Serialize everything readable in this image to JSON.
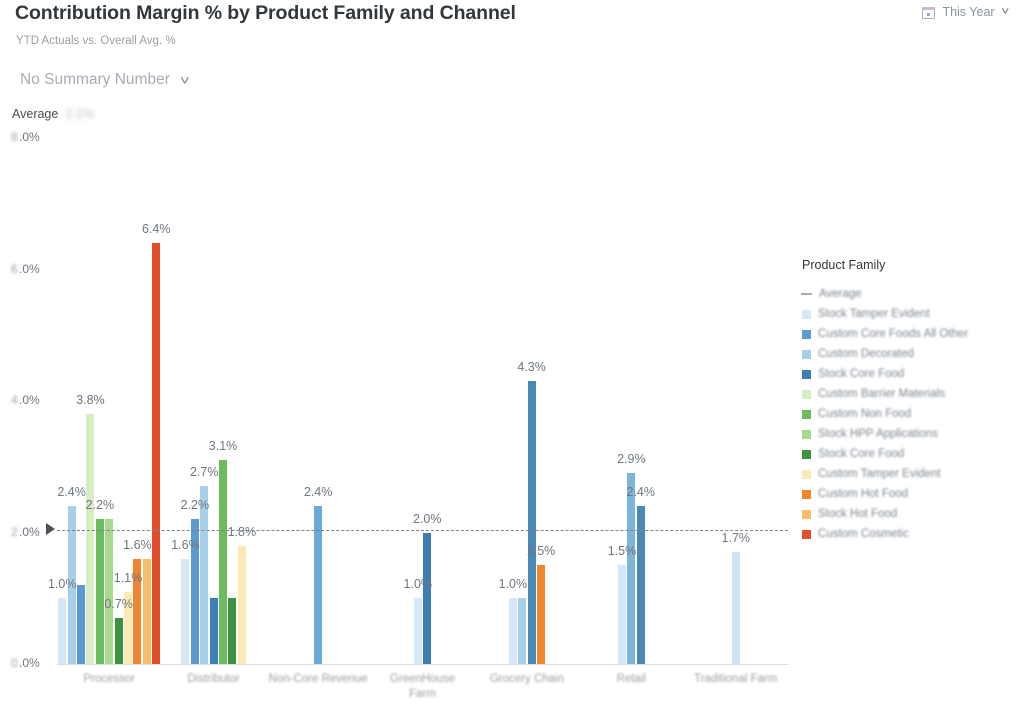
{
  "header": {
    "title": "Contribution Margin % by Product Family and Channel",
    "subtitle": "YTD Actuals vs. Overall Avg. %",
    "summary_select": "No Summary Number",
    "summary_chevron": "chevron-down-icon",
    "average_label": "Average",
    "average_value": "2.1%",
    "date_filter": "This Year",
    "calendar_icon": "calendar-icon",
    "date_chevron": "chevron-down-icon"
  },
  "legend": {
    "title": "Product Family",
    "items": [
      {
        "label": "Average",
        "color": "#b5a9a3",
        "type": "line"
      },
      {
        "label": "Stock Tamper Evident",
        "color": "#d6e7f7",
        "type": "swatch"
      },
      {
        "label": "Custom Core Foods All Other",
        "color": "#5b9bd1",
        "type": "swatch"
      },
      {
        "label": "Custom Decorated",
        "color": "#a8cfea",
        "type": "swatch"
      },
      {
        "label": "Stock Core Food",
        "color": "#3d7fb5",
        "type": "swatch"
      },
      {
        "label": "Custom Barrier Materials",
        "color": "#d8edc4",
        "type": "swatch"
      },
      {
        "label": "Custom Non Food",
        "color": "#6cbb5d",
        "type": "swatch"
      },
      {
        "label": "Stock HPP Applications",
        "color": "#a9d98e",
        "type": "swatch"
      },
      {
        "label": "Stock Core Food",
        "color": "#3f9142",
        "type": "swatch"
      },
      {
        "label": "Custom Tamper Evident",
        "color": "#fde8b8",
        "type": "swatch"
      },
      {
        "label": "Custom Hot Food",
        "color": "#f2862f",
        "type": "swatch"
      },
      {
        "label": "Stock Hot Food",
        "color": "#f9bd6a",
        "type": "swatch"
      },
      {
        "label": "Custom Cosmetic",
        "color": "#e04f2a",
        "type": "swatch"
      }
    ]
  },
  "chart_data": {
    "type": "bar",
    "title": "Contribution Margin % by Product Family and Channel",
    "subtitle": "YTD Actuals vs. Overall Avg. %",
    "xlabel": "",
    "ylabel": "",
    "ylim": [
      0,
      8
    ],
    "ytick_labels": [
      "8.0%",
      "6.0%",
      "4.0%",
      "2.0%",
      "0.0%"
    ],
    "ytick_values": [
      8.0,
      6.0,
      4.0,
      2.0,
      0.0
    ],
    "grid": false,
    "legend_position": "right",
    "value_format": "percent-1dp",
    "average_line": {
      "label": "Average",
      "value": 2.05,
      "style": "dashed"
    },
    "categories": [
      "Processor",
      "Distributor",
      "Non-Core Revenue",
      "GreenHouse Farm",
      "Grocery Chain",
      "Retail",
      "Traditional Farm"
    ],
    "groups": [
      {
        "category": "Processor",
        "bars": [
          {
            "series": "Stock Tamper Evident",
            "value": 1.0,
            "label": "1.0%",
            "color": "#d6e7f7"
          },
          {
            "series": "Custom Decorated",
            "value": 2.4,
            "label": "2.4%",
            "color": "#a8cfea"
          },
          {
            "series": "Custom Core Foods All Other",
            "value": 1.2,
            "label": "",
            "color": "#5b9bd1"
          },
          {
            "series": "Custom Barrier Materials",
            "value": 3.8,
            "label": "3.8%",
            "color": "#d8edc4"
          },
          {
            "series": "Custom Non Food",
            "value": 2.2,
            "label": "2.2%",
            "color": "#6cbb5d"
          },
          {
            "series": "Stock HPP Applications",
            "value": 2.2,
            "label": "",
            "color": "#a9d98e"
          },
          {
            "series": "Stock Core Food",
            "value": 0.7,
            "label": "0.7%",
            "color": "#3f9142"
          },
          {
            "series": "Custom Tamper Evident",
            "value": 1.1,
            "label": "1.1%",
            "color": "#fde8b8"
          },
          {
            "series": "Custom Hot Food",
            "value": 1.6,
            "label": "1.6%",
            "color": "#f2862f"
          },
          {
            "series": "Stock Hot Food",
            "value": 1.6,
            "label": "",
            "color": "#f9bd6a"
          },
          {
            "series": "Custom Cosmetic",
            "value": 6.4,
            "label": "6.4%",
            "color": "#e04f2a"
          }
        ]
      },
      {
        "category": "Distributor",
        "bars": [
          {
            "series": "Stock Tamper Evident",
            "value": 1.6,
            "label": "1.6%",
            "color": "#d6e7f7"
          },
          {
            "series": "Custom Core Foods All Other",
            "value": 2.2,
            "label": "2.2%",
            "color": "#5b9bd1"
          },
          {
            "series": "Custom Decorated",
            "value": 2.7,
            "label": "2.7%",
            "color": "#a8cfea"
          },
          {
            "series": "Stock Core Food",
            "value": 1.0,
            "label": "",
            "color": "#3d7fb5"
          },
          {
            "series": "Custom Non Food",
            "value": 3.1,
            "label": "3.1%",
            "color": "#6cbb5d"
          },
          {
            "series": "Stock Core Food",
            "value": 1.0,
            "label": "",
            "color": "#3f9142"
          },
          {
            "series": "Custom Tamper Evident",
            "value": 1.8,
            "label": "1.8%",
            "color": "#fde8b8"
          }
        ]
      },
      {
        "category": "Non-Core Revenue",
        "bars": [
          {
            "series": "Custom Decorated",
            "value": 2.4,
            "label": "2.4%",
            "color": "#6aa9d8"
          }
        ]
      },
      {
        "category": "GreenHouse Farm",
        "bars": [
          {
            "series": "Stock Tamper Evident",
            "value": 1.0,
            "label": "1.0%",
            "color": "#d6e7f7"
          },
          {
            "series": "Stock Core Food",
            "value": 2.0,
            "label": "2.0%",
            "color": "#3d7fb5"
          }
        ]
      },
      {
        "category": "Grocery Chain",
        "bars": [
          {
            "series": "Stock Tamper Evident",
            "value": 1.0,
            "label": "1.0%",
            "color": "#d6e7f7"
          },
          {
            "series": "Custom Decorated",
            "value": 1.0,
            "label": "",
            "color": "#a8cfea"
          },
          {
            "series": "Stock Core Food",
            "value": 4.3,
            "label": "4.3%",
            "color": "#4a88b5"
          },
          {
            "series": "Custom Hot Food",
            "value": 1.5,
            "label": "1.5%",
            "color": "#f2862f"
          }
        ]
      },
      {
        "category": "Retail",
        "bars": [
          {
            "series": "Stock Tamper Evident",
            "value": 1.5,
            "label": "1.5%",
            "color": "#d6e7f7"
          },
          {
            "series": "Custom Decorated",
            "value": 2.9,
            "label": "2.9%",
            "color": "#7fb4dd"
          },
          {
            "series": "Stock Core Food",
            "value": 2.4,
            "label": "2.4%",
            "color": "#4a88b5"
          }
        ]
      },
      {
        "category": "Traditional Farm",
        "bars": [
          {
            "series": "Stock Tamper Evident",
            "value": 1.7,
            "label": "1.7%",
            "color": "#cfe4f6"
          }
        ]
      }
    ]
  }
}
